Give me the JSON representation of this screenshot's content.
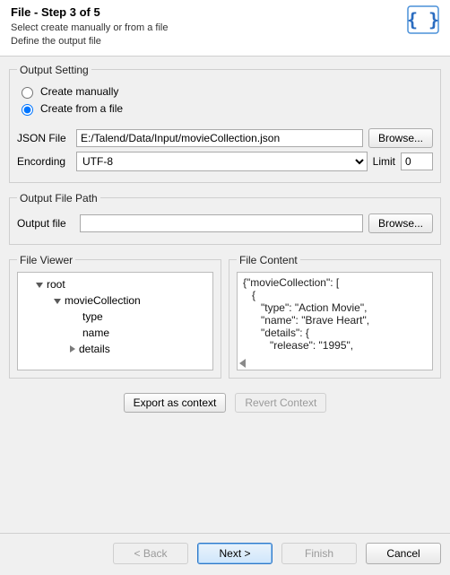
{
  "header": {
    "title": "File - Step 3 of 5",
    "sub1": "Select create manually or from a file",
    "sub2": "Define the output file"
  },
  "outputSetting": {
    "legend": "Output Setting",
    "createManually": "Create manually",
    "createFromFile": "Create from a file",
    "jsonFileLabel": "JSON File",
    "jsonFileValue": "E:/Talend/Data/Input/movieCollection.json",
    "browse": "Browse...",
    "encodingLabel": "Encording",
    "encodingValue": "UTF-8",
    "limitLabel": "Limit",
    "limitValue": "0"
  },
  "outputFilePath": {
    "legend": "Output File Path",
    "outputFileLabel": "Output file",
    "outputFileValue": "",
    "browse": "Browse..."
  },
  "fileViewer": {
    "legend": "File Viewer",
    "nodes": {
      "root": "root",
      "movieCollection": "movieCollection",
      "type": "type",
      "name": "name",
      "details": "details"
    }
  },
  "fileContent": {
    "legend": "File Content",
    "line1": "{\"movieCollection\": [",
    "line2": "   {",
    "line3": "      \"type\": \"Action Movie\",",
    "line4": "      \"name\": \"Brave Heart\",",
    "line5": "      \"details\": {",
    "line6": "         \"release\": \"1995\","
  },
  "context": {
    "export": "Export as context",
    "revert": "Revert Context"
  },
  "footer": {
    "back": "< Back",
    "next": "Next >",
    "finish": "Finish",
    "cancel": "Cancel"
  }
}
